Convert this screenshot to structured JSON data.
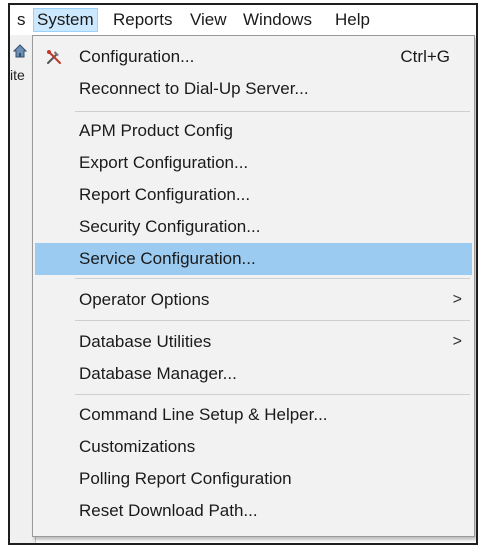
{
  "menubar": {
    "items": [
      {
        "label": "s"
      },
      {
        "label": "System"
      },
      {
        "label": "Reports"
      },
      {
        "label": "View"
      },
      {
        "label": "Windows"
      },
      {
        "label": "Help"
      }
    ]
  },
  "leftstrip": {
    "text": "ite"
  },
  "system_menu": {
    "items": [
      {
        "label": "Configuration...",
        "shortcut": "Ctrl+G",
        "icon": "tools-icon"
      },
      {
        "label": "Reconnect to Dial-Up Server..."
      },
      {
        "label": "APM Product Config"
      },
      {
        "label": "Export Configuration..."
      },
      {
        "label": "Report Configuration..."
      },
      {
        "label": "Security Configuration..."
      },
      {
        "label": "Service Configuration...",
        "highlighted": true
      },
      {
        "label": "Operator Options",
        "submenu": ">"
      },
      {
        "label": "Database Utilities",
        "submenu": ">"
      },
      {
        "label": "Database Manager..."
      },
      {
        "label": "Command Line Setup & Helper..."
      },
      {
        "label": "Customizations"
      },
      {
        "label": "Polling Report Configuration"
      },
      {
        "label": "Reset Download Path..."
      }
    ]
  },
  "colors": {
    "highlight": "#9bcbf1",
    "menubar_open": "#cce8ff",
    "menu_bg": "#f2f2f2"
  }
}
